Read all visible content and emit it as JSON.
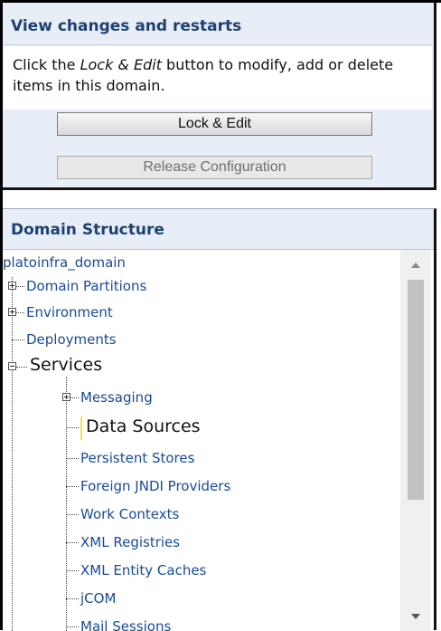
{
  "change_center": {
    "title": "View changes and restarts",
    "description_prefix": "Click the ",
    "description_emphasis": "Lock & Edit",
    "description_suffix": " button to modify, add or delete items in this domain.",
    "lock_edit_label": "Lock & Edit",
    "release_label": "Release Configuration"
  },
  "domain_structure": {
    "title": "Domain Structure",
    "root": "platoinfra_domain",
    "items": [
      {
        "label": "Domain Partitions",
        "expandable": true
      },
      {
        "label": "Environment",
        "expandable": true
      },
      {
        "label": "Deployments",
        "expandable": false
      },
      {
        "label": "Services",
        "expandable": true,
        "expanded": true
      },
      {
        "label": "Messaging",
        "expandable": true
      },
      {
        "label": "Data Sources",
        "expandable": false
      },
      {
        "label": "Persistent Stores",
        "expandable": false
      },
      {
        "label": "Foreign JNDI Providers",
        "expandable": false
      },
      {
        "label": "Work Contexts",
        "expandable": false
      },
      {
        "label": "XML Registries",
        "expandable": false
      },
      {
        "label": "XML Entity Caches",
        "expandable": false
      },
      {
        "label": "jCOM",
        "expandable": false
      },
      {
        "label": "Mail Sessions",
        "expandable": false
      }
    ]
  },
  "colors": {
    "panel_bg": "#e8eef8",
    "title": "#1d4171",
    "link": "#1a4a9a"
  },
  "icons": [
    "plus-expander-icon",
    "minus-expander-icon",
    "scroll-up-arrow-icon",
    "scroll-down-arrow-icon"
  ]
}
